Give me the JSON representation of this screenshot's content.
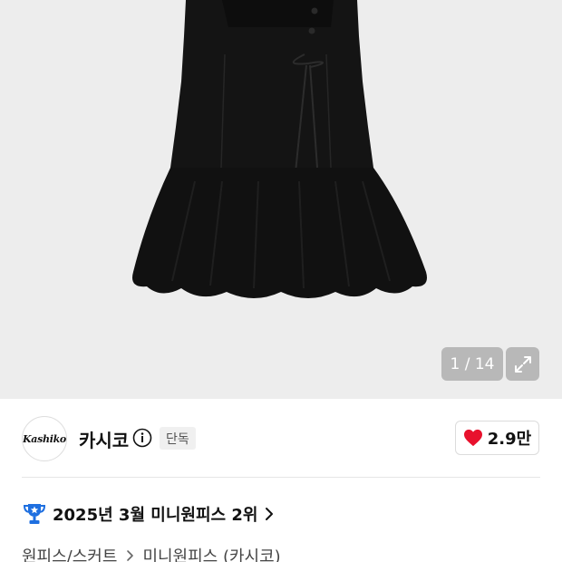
{
  "gallery": {
    "image_alt": "black mini dress",
    "counter": "1 / 14",
    "expand_icon": "expand-icon"
  },
  "brand": {
    "logo_text": "Kashiko",
    "name": "카시코",
    "info_icon": "info-icon",
    "badge": "단독"
  },
  "like": {
    "icon": "heart-icon",
    "count": "2.9만",
    "color": "#e8112d"
  },
  "ranking": {
    "icon": "trophy-icon",
    "text": "2025년 3월 미니원피스 2위"
  },
  "breadcrumb": {
    "items": [
      "원피스/스커트",
      "미니원피스 (카시코)"
    ]
  }
}
